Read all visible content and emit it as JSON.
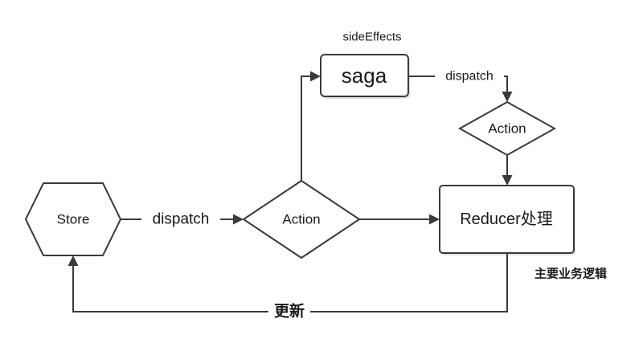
{
  "nodes": {
    "store": "Store",
    "action_main": "Action",
    "saga": "saga",
    "action_saga": "Action",
    "reducer": "Reducer处理"
  },
  "labels": {
    "side_effects": "sideEffects",
    "dispatch_store": "dispatch",
    "dispatch_saga": "dispatch",
    "update": "更新",
    "business_logic": "主要业务逻辑"
  }
}
